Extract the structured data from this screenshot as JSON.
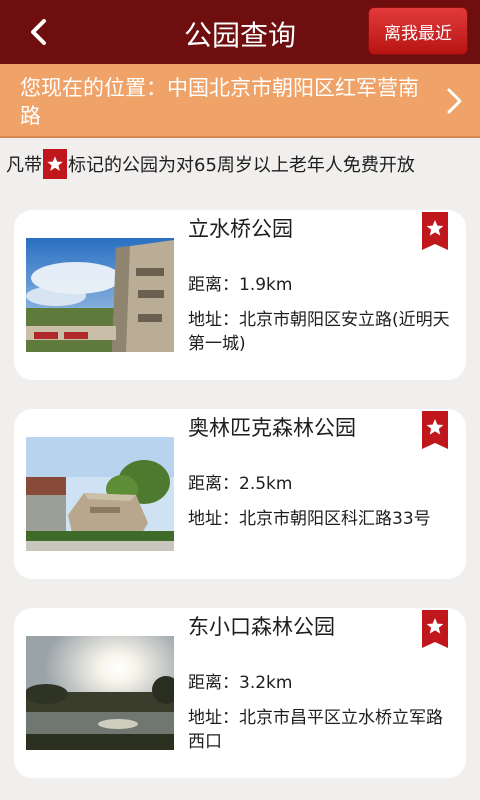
{
  "header": {
    "title": "公园查询",
    "near_button": "离我最近"
  },
  "location": {
    "text": "您现在的位置：中国北京市朝阳区红军营南路"
  },
  "notice": {
    "before": "凡带",
    "after": "标记的公园为对65周岁以上老年人免费开放"
  },
  "parks": [
    {
      "name": "立水桥公园",
      "distance": "距离：1.9km",
      "address": "地址：北京市朝阳区安立路(近明天第一城)"
    },
    {
      "name": "奥林匹克森林公园",
      "distance": "距离：2.5km",
      "address": "地址：北京市朝阳区科汇路33号"
    },
    {
      "name": "东小口森林公园",
      "distance": "距离：3.2km",
      "address": "地址：北京市昌平区立水桥立军路西口"
    }
  ],
  "colors": {
    "header": "#6e0e0e",
    "location_bar": "#f0a368",
    "badge": "#c0171d",
    "near_button": "#c91f1f"
  },
  "icons": {
    "back": "chevron-left-icon",
    "location_arrow": "chevron-right-icon",
    "free_badge": "star-badge-icon"
  }
}
